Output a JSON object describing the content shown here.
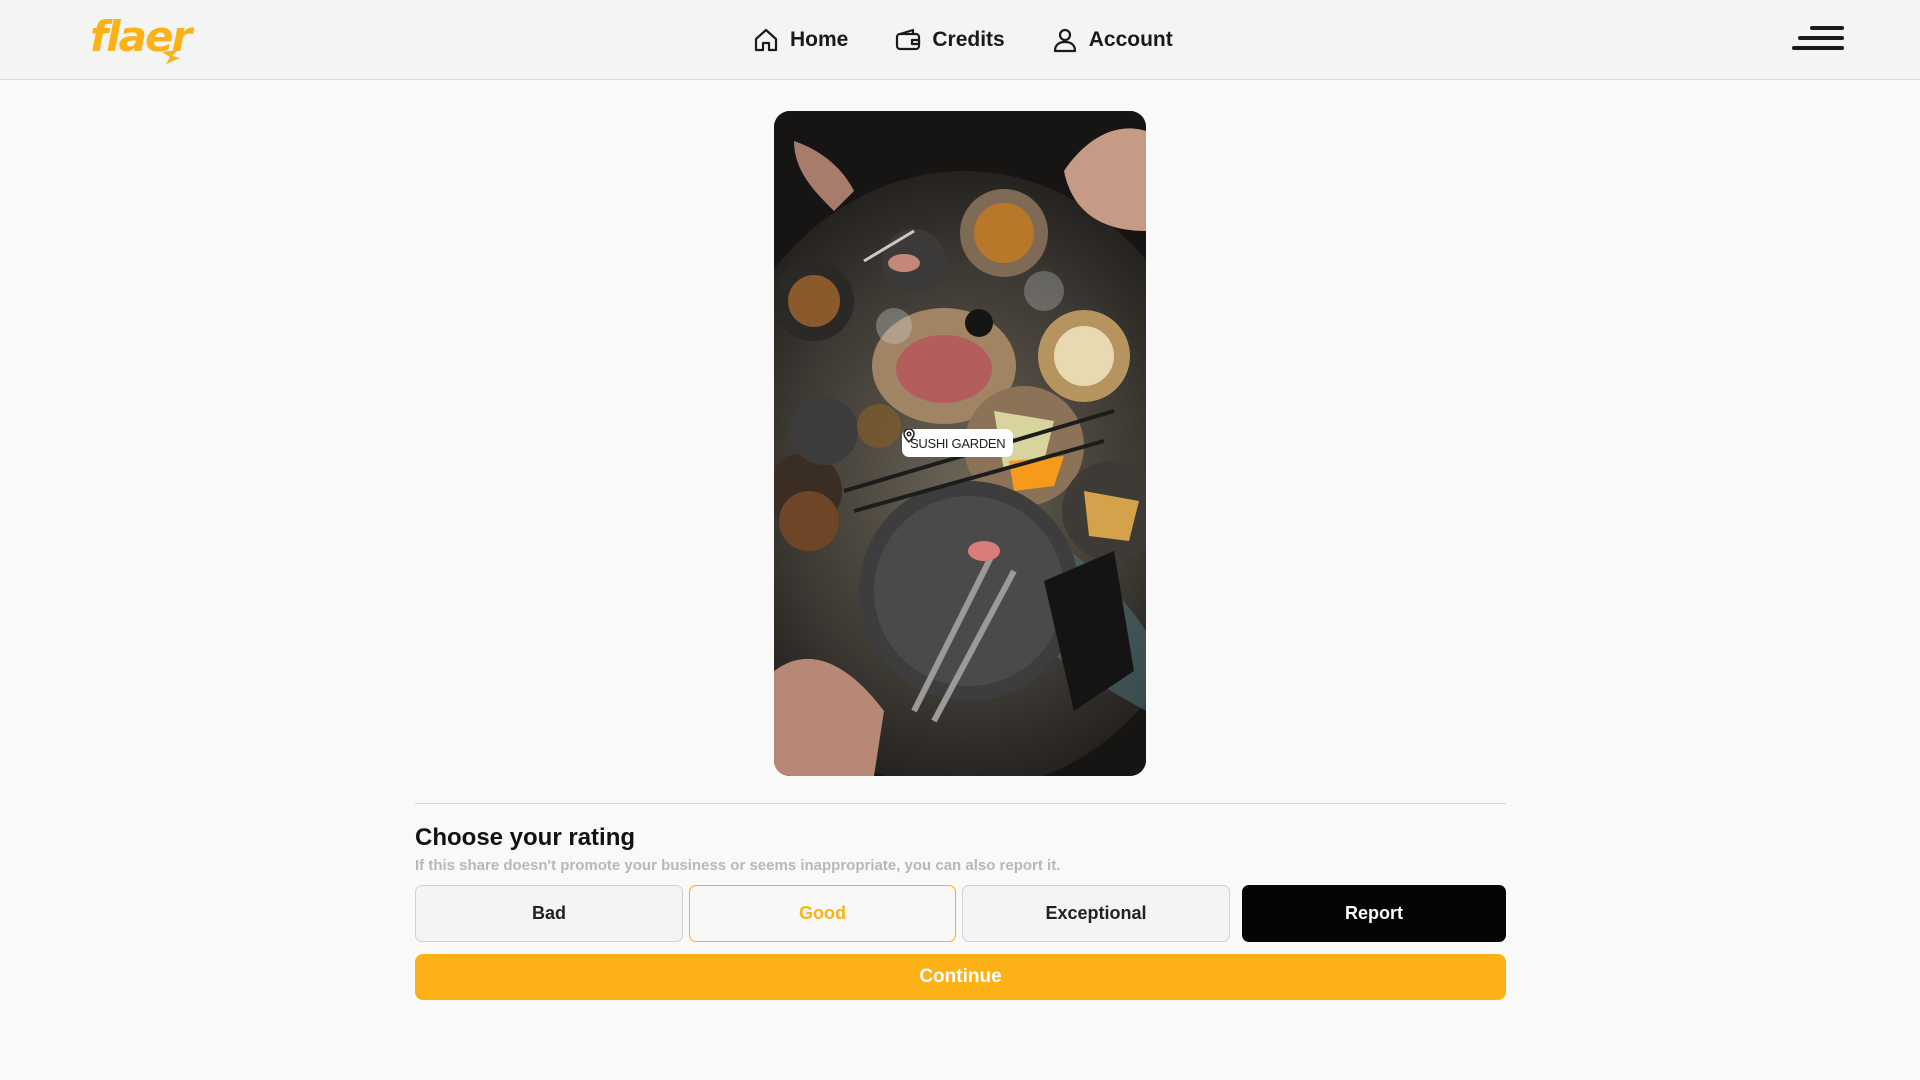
{
  "brand": {
    "logo_text": "flaer",
    "accent_color": "#fcb116"
  },
  "nav": {
    "items": [
      {
        "label": "Home",
        "icon": "home-icon"
      },
      {
        "label": "Credits",
        "icon": "wallet-icon"
      },
      {
        "label": "Account",
        "icon": "user-icon"
      }
    ],
    "menu_icon": "hamburger-menu-icon"
  },
  "story": {
    "location_label": "SUSHI GARDEN",
    "location_icon": "map-pin-icon"
  },
  "rating": {
    "title": "Choose your rating",
    "subtitle": "If this share doesn't promote your business or seems inappropriate, you can also report it.",
    "options": [
      {
        "label": "Bad",
        "selected": false
      },
      {
        "label": "Good",
        "selected": true
      },
      {
        "label": "Exceptional",
        "selected": false
      }
    ],
    "report_label": "Report",
    "continue_label": "Continue"
  }
}
